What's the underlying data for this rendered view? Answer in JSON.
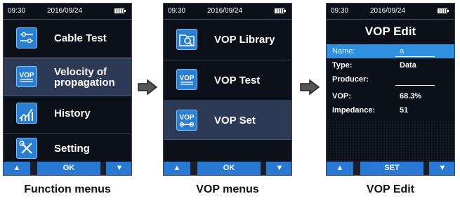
{
  "screens": [
    {
      "status": {
        "time": "09:30",
        "date": "2016/09/24"
      },
      "items": [
        {
          "label": [
            "Cable Test"
          ],
          "icon": "cable-test-icon"
        },
        {
          "label": [
            "Velocity of",
            "propagation"
          ],
          "icon": "vop-icon",
          "selected": true
        },
        {
          "label": [
            "History"
          ],
          "icon": "history-chart-icon"
        },
        {
          "label": [
            "Setting"
          ],
          "icon": "settings-tools-icon"
        }
      ],
      "buttons": {
        "up": "▲",
        "mid": "OK",
        "down": "▼"
      },
      "caption": "Function menus"
    },
    {
      "status": {
        "time": "09:30",
        "date": "2016/09/24"
      },
      "items": [
        {
          "label": [
            "VOP Library"
          ],
          "icon": "vop-library-icon"
        },
        {
          "label": [
            "VOP Test"
          ],
          "icon": "vop-test-icon"
        },
        {
          "label": [
            "VOP Set"
          ],
          "icon": "vop-set-icon",
          "selected": true
        }
      ],
      "buttons": {
        "up": "▲",
        "mid": "OK",
        "down": "▼"
      },
      "caption": "VOP menus"
    },
    {
      "status": {
        "time": "09:30",
        "date": "2016/09/24"
      },
      "title": "VOP Edit",
      "fields": [
        {
          "key": "Name:",
          "value": "a",
          "highlighted": true
        },
        {
          "key": "Type:",
          "value": "Data"
        },
        {
          "key": "Producer:",
          "value": ""
        },
        {
          "key": "VOP:",
          "value": "68.3%"
        },
        {
          "key": "Impedance:",
          "value": "51"
        }
      ],
      "buttons": {
        "up": "▲",
        "mid": "SET",
        "down": "▼"
      },
      "caption": "VOP Edit"
    }
  ],
  "colors": {
    "screen_bg": "#0c1018",
    "accent": "#2979d2",
    "selected_row": "#2d3a55",
    "highlight_field": "#2f8fe0"
  }
}
